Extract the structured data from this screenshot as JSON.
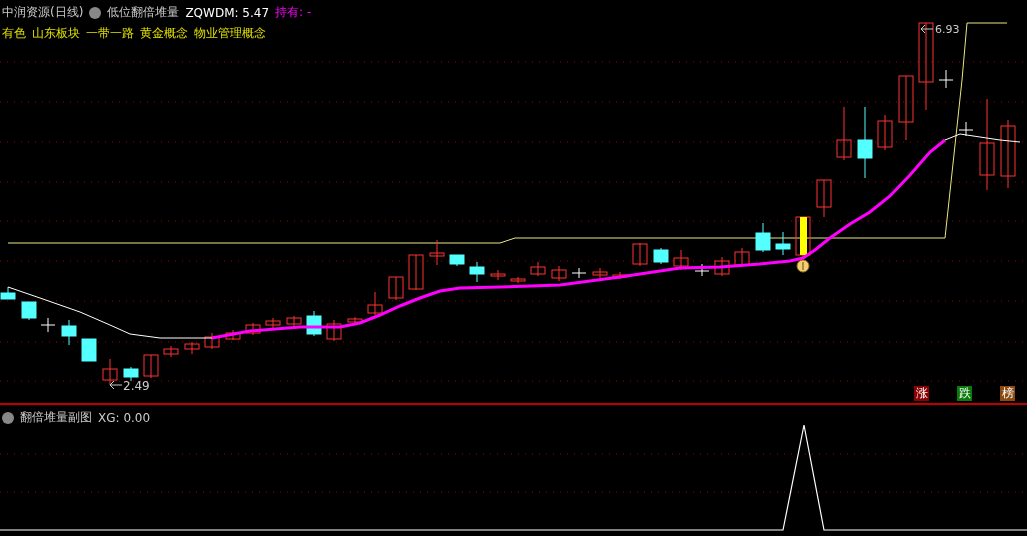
{
  "header": {
    "stock": "中润资源(日线)",
    "indicator": "低位翻倍堆量",
    "value_label": "ZQWDM: 5.47",
    "holding": "持有: -"
  },
  "tags": [
    "有色",
    "山东板块",
    "一带一路",
    "黄金概念",
    "物业管理概念"
  ],
  "price_labels": {
    "high": "6.93",
    "low": "2.49"
  },
  "subchart": {
    "indicator": "翻倍堆量副图",
    "value_label": "XG: 0.00"
  },
  "buttons": [
    {
      "label": "涨",
      "color": "#8b0000"
    },
    {
      "label": "跌",
      "color": "#0a7a0a"
    },
    {
      "label": "榜",
      "color": "#8b4a10"
    }
  ]
}
